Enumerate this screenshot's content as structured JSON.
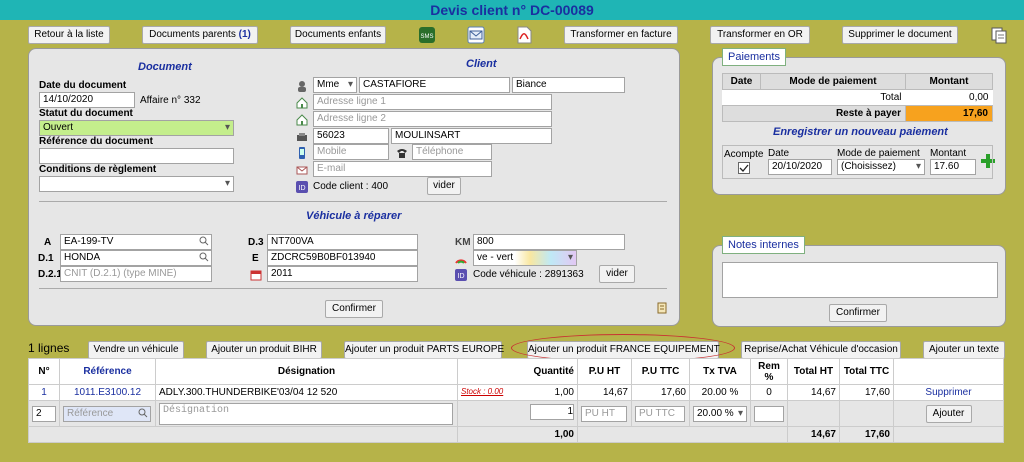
{
  "title": "Devis client n° DC-00089",
  "toolbar": {
    "back": "Retour à la liste",
    "parents": "Documents parents",
    "parents_count": "(1)",
    "children": "Documents enfants",
    "to_invoice": "Transformer en facture",
    "to_or": "Transformer en OR",
    "delete": "Supprimer le document"
  },
  "document": {
    "section": "Document",
    "date_label": "Date du document",
    "date": "14/10/2020",
    "affaire": "Affaire n° 332",
    "status_label": "Statut du document",
    "status": "Ouvert",
    "ref_label": "Référence du document",
    "ref": "",
    "cond_label": "Conditions de règlement",
    "cond": ""
  },
  "client": {
    "section": "Client",
    "civility": "Mme",
    "lastname": "CASTAFIORE",
    "firstname": "Biance",
    "addr1_ph": "Adresse ligne 1",
    "addr2_ph": "Adresse ligne 2",
    "zip": "56023",
    "city": "MOULINSART",
    "mobile_ph": "Mobile",
    "phone_ph": "Téléphone",
    "email_ph": "E-mail",
    "code": "Code client : 400",
    "clear": "vider"
  },
  "vehicle": {
    "section": "Véhicule à réparer",
    "a_label": "A",
    "a": "EA-199-TV",
    "d1_label": "D.1",
    "d1": "HONDA",
    "d21_label": "D.2.1",
    "d21_ph": "CNIT (D.2.1) (type MINE)",
    "d3_label": "D.3",
    "d3": "NT700VA",
    "e_label": "E",
    "e": "ZDCRC59B0BF013940",
    "year": "2011",
    "km_label": "KM",
    "km": "800",
    "color": "ve - vert",
    "code": "Code véhicule : 2891363",
    "clear": "vider",
    "confirm": "Confirmer"
  },
  "payments": {
    "legend": "Paiements",
    "headers": [
      "Date",
      "Mode de paiement",
      "Montant"
    ],
    "total_label": "Total",
    "total": "0,00",
    "remaining_label": "Reste à payer",
    "remaining": "17,60",
    "new_title": "Enregistrer un nouveau paiement",
    "acompte": "Acompte",
    "date_label": "Date",
    "date": "20/10/2020",
    "mode_label": "Mode de paiement",
    "mode": "(Choisissez)",
    "amount_label": "Montant",
    "amount": "17.60"
  },
  "notes": {
    "legend": "Notes internes",
    "confirm": "Confirmer"
  },
  "lines": {
    "count": "1 lignes",
    "sell_vehicle": "Vendre un véhicule",
    "add_bihr": "Ajouter un produit BIHR",
    "add_parts_europe": "Ajouter un produit PARTS EUROPE",
    "add_france_equipement": "Ajouter un produit FRANCE EQUIPEMENT",
    "reprise": "Reprise/Achat Véhicule d'occasion",
    "add_text": "Ajouter un texte",
    "headers": [
      "N°",
      "Référence",
      "Désignation",
      "Quantité",
      "P.U HT",
      "P.U TTC",
      "Tx TVA",
      "Rem %",
      "Total HT",
      "Total TTC",
      ""
    ],
    "rows": [
      {
        "n": "1",
        "ref": "1011.E3100.12",
        "designation": "ADLY.300.THUNDERBIKE'03/04 12 520",
        "stock": "Stock : 0.00",
        "qty": "1,00",
        "pu_ht": "14,67",
        "pu_ttc": "17,60",
        "tva": "20.00 %",
        "rem": "0",
        "total_ht": "14,67",
        "total_ttc": "17,60",
        "action": "Supprimer"
      }
    ],
    "new_row": {
      "n": "2",
      "ref_ph": "Référence",
      "des_ph": "Désignation",
      "qty": "1",
      "pu_ht_ph": "PU HT",
      "pu_ttc_ph": "PU TTC",
      "tva": "20.00 %",
      "add": "Ajouter"
    },
    "totals": {
      "qty": "1,00",
      "total_ht": "14,67",
      "total_ttc": "17,60"
    }
  }
}
